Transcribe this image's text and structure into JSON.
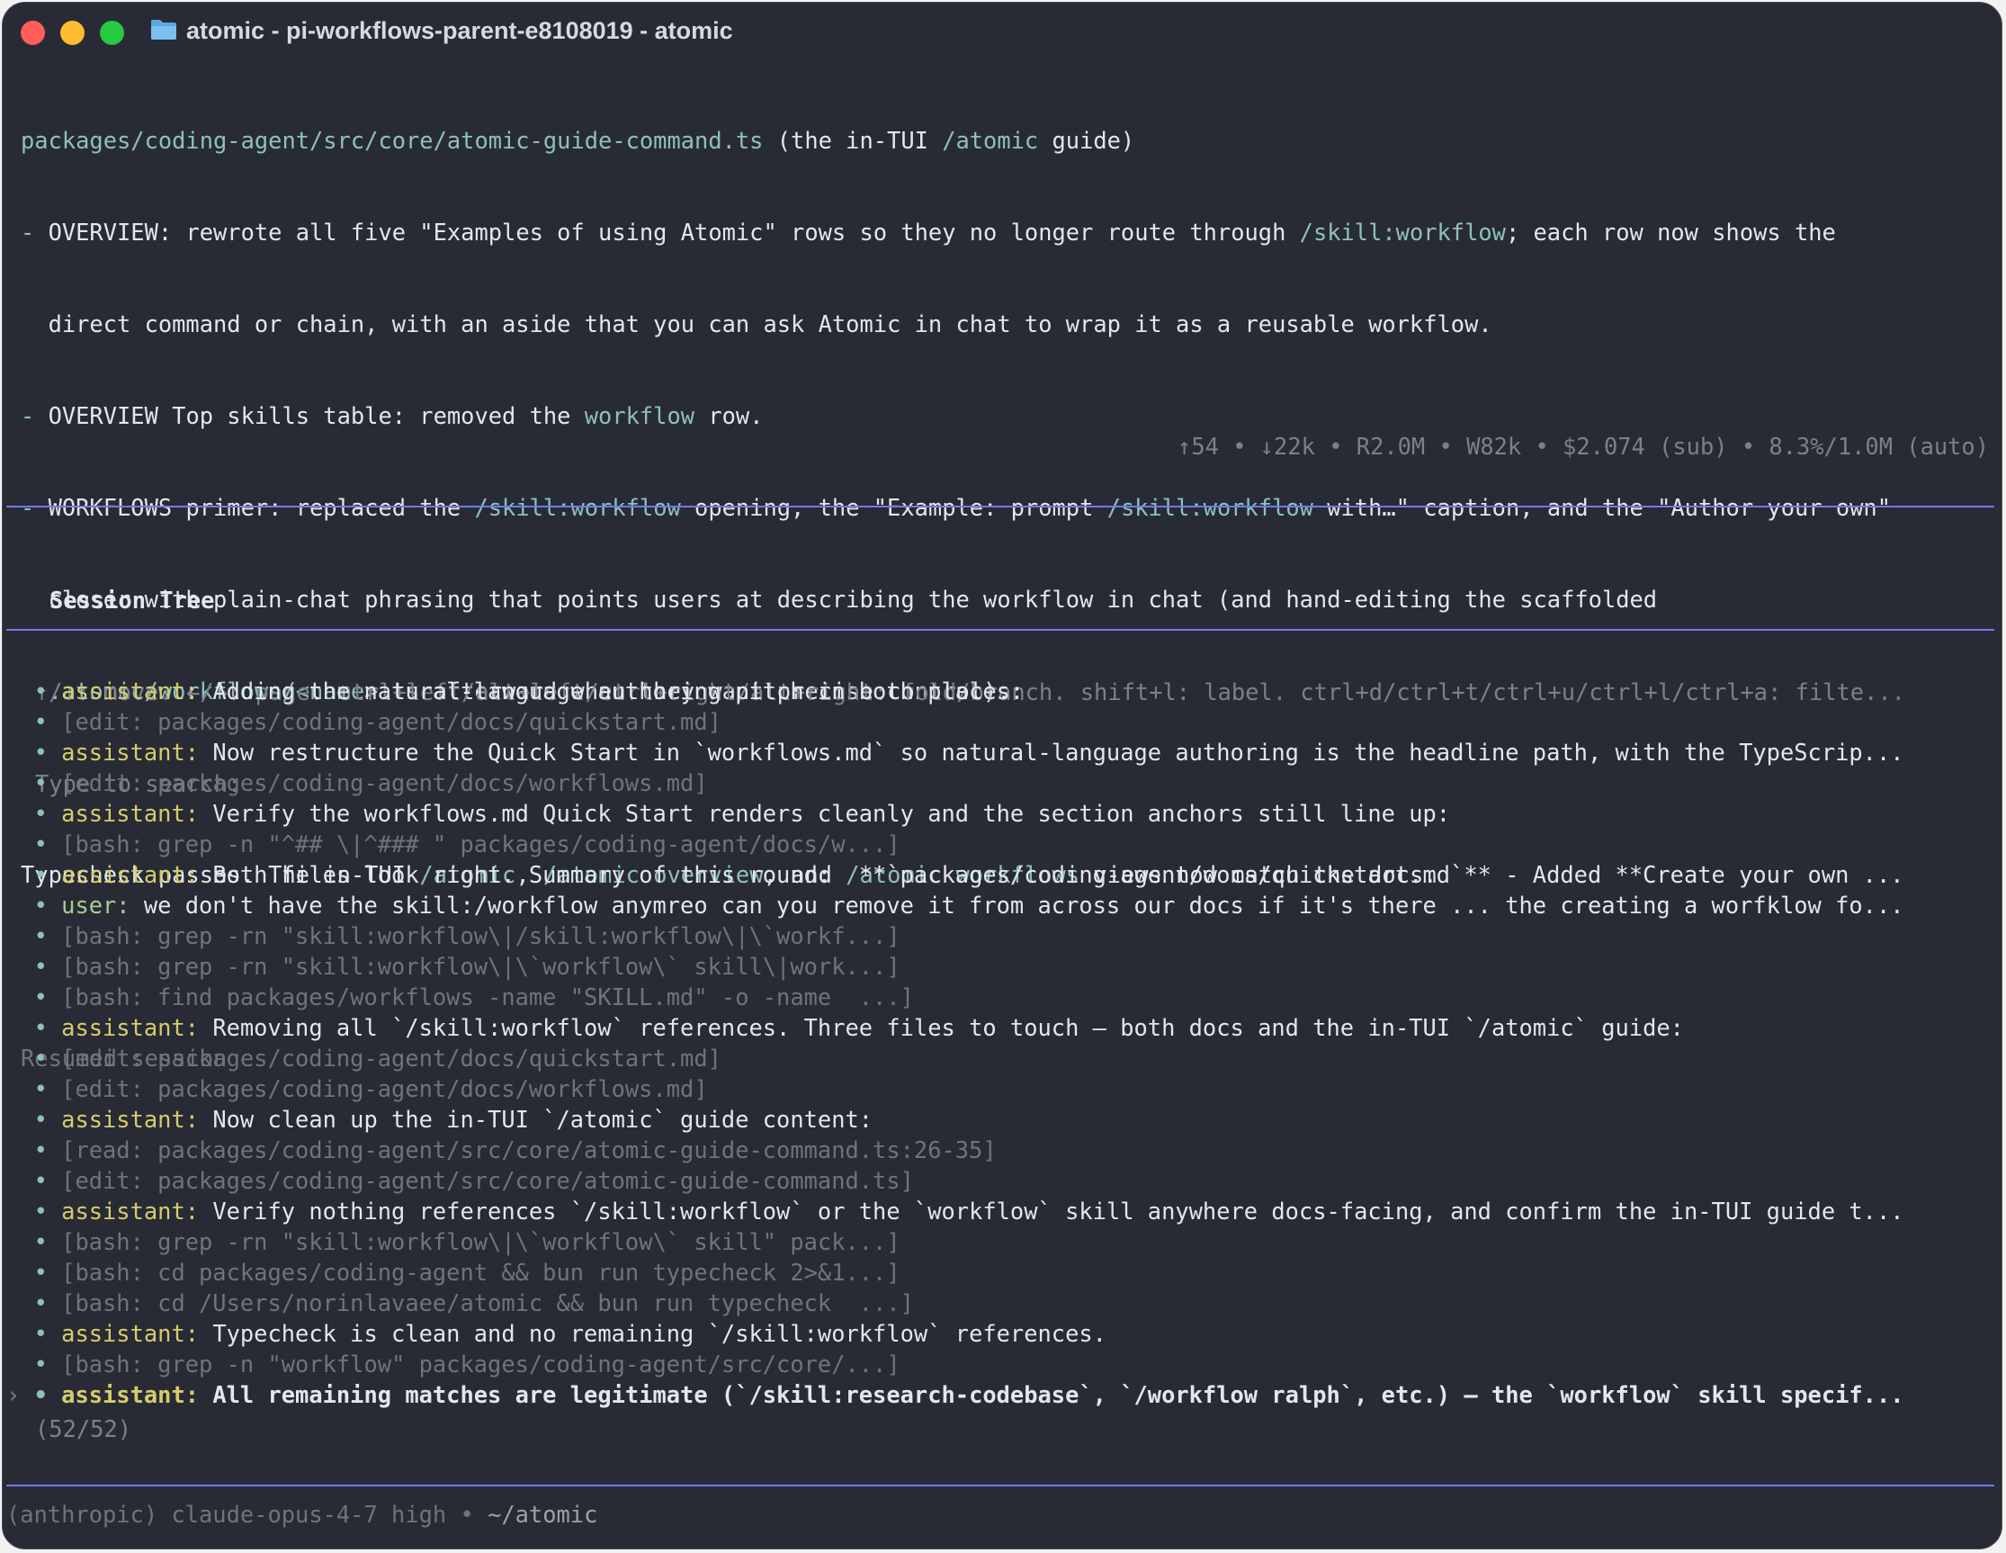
{
  "window": {
    "title": "atomic - pi-workflows-parent-e8108019 - atomic",
    "folder_icon": "folder-icon"
  },
  "output": {
    "line1_path": "packages/coding-agent/src/core/atomic-guide-command.ts",
    "line1_a": " (the in-TUI ",
    "line1_cmd": "/atomic",
    "line1_b": " guide)",
    "l2_a": "- ",
    "l2_b": "OVERVIEW: rewrote all five \"Examples of using Atomic\" rows so they no longer route through ",
    "l2_cmd": "/skill:workflow",
    "l2_c": "; each row now shows the",
    "l3": "  direct command or chain, with an aside that you can ask Atomic in chat to wrap it as a reusable workflow.",
    "l4_a": "- ",
    "l4_b": "OVERVIEW Top skills table: removed the ",
    "l4_cmd": "workflow",
    "l4_c": " row.",
    "l5_a": "- ",
    "l5_b": "WORKFLOWS primer: replaced the ",
    "l5_cmd1": "/skill:workflow",
    "l5_c": " opening, the \"Example: prompt ",
    "l5_cmd2": "/skill:workflow",
    "l5_d": " with…\" caption, and the \"Author your own\"",
    "l6": "  closer with plain-chat phrasing that points users at describing the workflow in chat (and hand-editing the scaffolded",
    "l7_a": "  ",
    "l7_path": ".atomic/workflows/<name>.ts",
    "l7_b": " afterward when they want precise control).",
    "l9_a": "Typecheck passes. The in-TUI ",
    "l9_cmd1": "/atomic",
    "l9_b": ", ",
    "l9_cmd2": "/atomic overview",
    "l9_c": ", and ",
    "l9_cmd3": "/atomic workflows",
    "l9_d": " views now match the docs.",
    "resumed": "Resumed session"
  },
  "stats": {
    "up": "↑54",
    "down": "↓22k",
    "read": "R2.0M",
    "write": "W82k",
    "cost": "$2.074",
    "sub": "(sub)",
    "context": "8.3%/1.0M",
    "auto": "(auto)",
    "sep": " • "
  },
  "session_tree": {
    "title": "Session Tree",
    "help": "↑/↓: move. ←/→: page. ctrl+left/alt+left/ctrl+right/alt+right: fold/branch. shift+l: label. ctrl+d/ctrl+t/ctrl+u/ctrl+l/ctrl+a: filte...",
    "search_placeholder": "Type to search:",
    "items": [
      {
        "role": "assistant: ",
        "text": "Adding the natural-language authoring pitch in both places:"
      },
      {
        "tool": "[edit: packages/coding-agent/docs/quickstart.md]"
      },
      {
        "role": "assistant: ",
        "text": "Now restructure the Quick Start in `workflows.md` so natural-language authoring is the headline path, with the TypeScrip..."
      },
      {
        "tool": "[edit: packages/coding-agent/docs/workflows.md]"
      },
      {
        "role": "assistant: ",
        "text": "Verify the workflows.md Quick Start renders cleanly and the section anchors still line up:"
      },
      {
        "tool": "[bash: grep -n \"^## \\|^### \" packages/coding-agent/docs/w...]"
      },
      {
        "role": "assistant: ",
        "text": "Both files look right. Summary of this round:  **`packages/coding-agent/docs/quickstart.md`** - Added **Create your own ..."
      },
      {
        "role": "user: ",
        "text": "we don't have the skill:/workflow anymreo can you remove it from across our docs if it's there ... the creating a worfklow fo..."
      },
      {
        "tool": "[bash: grep -rn \"skill:workflow\\|/skill:workflow\\|\\`workf...]"
      },
      {
        "tool": "[bash: grep -rn \"skill:workflow\\|\\`workflow\\` skill\\|work...]"
      },
      {
        "tool": "[bash: find packages/workflows -name \"SKILL.md\" -o -name  ...]"
      },
      {
        "role": "assistant: ",
        "text": "Removing all `/skill:workflow` references. Three files to touch — both docs and the in-TUI `/atomic` guide:"
      },
      {
        "tool": "[edit: packages/coding-agent/docs/quickstart.md]"
      },
      {
        "tool": "[edit: packages/coding-agent/docs/workflows.md]"
      },
      {
        "role": "assistant: ",
        "text": "Now clean up the in-TUI `/atomic` guide content:"
      },
      {
        "tool": "[read: packages/coding-agent/src/core/atomic-guide-command.ts:26-35]"
      },
      {
        "tool": "[edit: packages/coding-agent/src/core/atomic-guide-command.ts]"
      },
      {
        "role": "assistant: ",
        "text": "Verify nothing references `/skill:workflow` or the `workflow` skill anywhere docs-facing, and confirm the in-TUI guide t..."
      },
      {
        "tool": "[bash: grep -rn \"skill:workflow\\|\\`workflow\\` skill\" pack...]"
      },
      {
        "tool": "[bash: cd packages/coding-agent && bun run typecheck 2>&1...]"
      },
      {
        "tool": "[bash: cd /Users/norinlavaee/atomic && bun run typecheck  ...]"
      },
      {
        "role": "assistant: ",
        "text": "Typecheck is clean and no remaining `/skill:workflow` references."
      },
      {
        "tool": "[bash: grep -n \"workflow\" packages/coding-agent/src/core/...]"
      },
      {
        "role": "assistant: ",
        "text": "All remaining matches are legitimate (`/skill:research-codebase`, `/workflow ralph`, etc.) — the `workflow` skill specif...",
        "selected": true
      }
    ],
    "bullet": "• ",
    "cursor": "›",
    "count": "(52/52)"
  },
  "footer": {
    "provider": "(anthropic)",
    "model": "claude-opus-4-7",
    "effort": "high",
    "sep": " • ",
    "cwd": "~/atomic"
  },
  "colors": {
    "background": "#282b35",
    "accent_line": "#6c7ce6",
    "assistant_role": "#d6cc6a",
    "user_role": "#a6ce8e",
    "command": "#8ec0bc",
    "dim": "#6e737e"
  }
}
